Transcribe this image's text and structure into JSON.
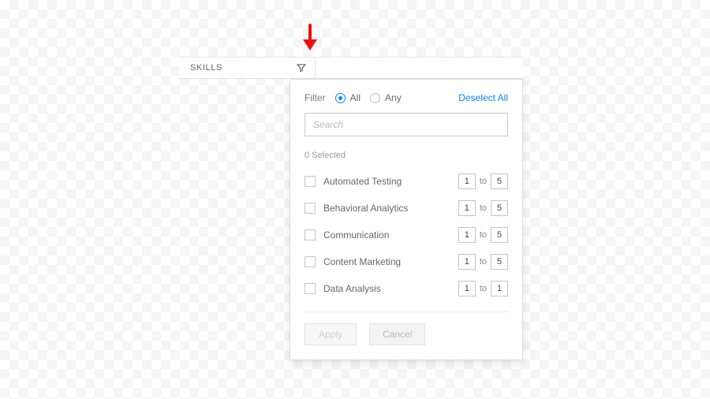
{
  "column": {
    "label": "SKILLS"
  },
  "arrow": {
    "color": "#ee1111"
  },
  "filter": {
    "label": "Filter",
    "mode_all": "All",
    "mode_any": "Any",
    "selected_mode": "All",
    "deselect_label": "Deselect All"
  },
  "search": {
    "placeholder": "Search"
  },
  "selected_count_text": "0 Selected",
  "range_word": "to",
  "skills": [
    {
      "name": "Automated Testing",
      "min": "1",
      "max": "5"
    },
    {
      "name": "Behavioral Analytics",
      "min": "1",
      "max": "5"
    },
    {
      "name": "Communication",
      "min": "1",
      "max": "5"
    },
    {
      "name": "Content Marketing",
      "min": "1",
      "max": "5"
    },
    {
      "name": "Data Analysis",
      "min": "1",
      "max": "1"
    }
  ],
  "buttons": {
    "apply": "Apply",
    "cancel": "Cancel"
  }
}
